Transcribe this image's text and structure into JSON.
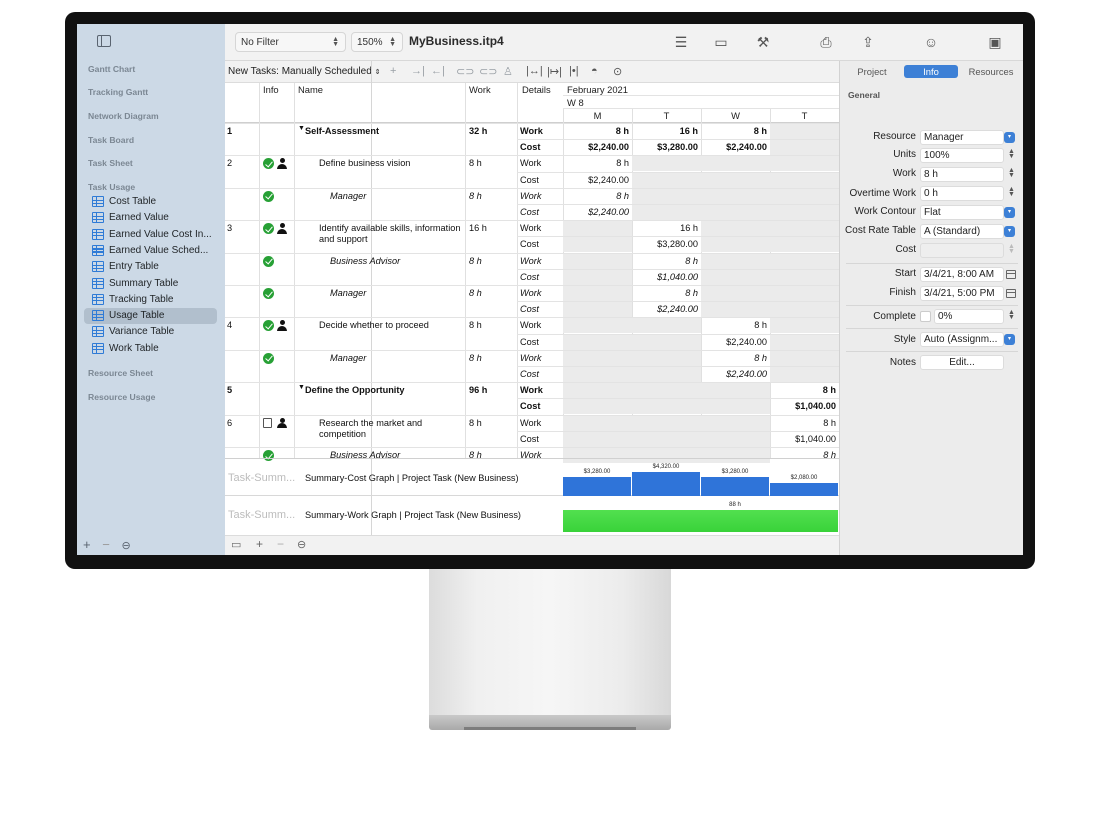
{
  "sidebar": {
    "sections": {
      "gantt": "Gantt Chart",
      "tracking": "Tracking Gantt",
      "network": "Network Diagram",
      "board": "Task Board",
      "sheet": "Task Sheet",
      "usage": "Task Usage",
      "res_sheet": "Resource Sheet",
      "res_usage": "Resource Usage"
    },
    "items": [
      {
        "label": "Cost Table"
      },
      {
        "label": "Earned Value"
      },
      {
        "label": "Earned Value Cost In..."
      },
      {
        "label": "Earned Value Sched..."
      },
      {
        "label": "Entry Table"
      },
      {
        "label": "Summary Table"
      },
      {
        "label": "Tracking Table"
      },
      {
        "label": "Usage Table"
      },
      {
        "label": "Variance Table"
      },
      {
        "label": "Work Table"
      }
    ],
    "selected": "Usage Table"
  },
  "toolbar": {
    "filter": "No Filter",
    "zoom": "150%",
    "title": "MyBusiness.itp4"
  },
  "bar2": {
    "new_tasks": "New Tasks: Manually Scheduled"
  },
  "table": {
    "headers": {
      "info": "Info",
      "name": "Name",
      "work": "Work",
      "details": "Details"
    },
    "timescale": {
      "month": "February 2021",
      "week": "W 8",
      "days": [
        "M",
        "T",
        "W",
        "T"
      ]
    },
    "rows": [
      {
        "id": "1",
        "name": "Self-Assessment",
        "work": "32 h",
        "type": "summary",
        "lines": [
          [
            "Work",
            "8 h",
            "16 h",
            "8 h",
            ""
          ],
          [
            "Cost",
            "$2,240.00",
            "$3,280.00",
            "$2,240.00",
            ""
          ]
        ]
      },
      {
        "id": "2",
        "name": "Define business vision",
        "work": "8 h",
        "type": "task",
        "lines": [
          [
            "Work",
            "8 h",
            "",
            "",
            ""
          ],
          [
            "Cost",
            "$2,240.00",
            "",
            "",
            ""
          ]
        ]
      },
      {
        "id": "",
        "name": "Manager",
        "work": "8 h",
        "type": "assign",
        "lines": [
          [
            "Work",
            "8 h",
            "",
            "",
            ""
          ],
          [
            "Cost",
            "$2,240.00",
            "",
            "",
            ""
          ]
        ]
      },
      {
        "id": "3",
        "name": "Identify available skills, information",
        "name2": "and support",
        "work": "16 h",
        "type": "task",
        "lines": [
          [
            "Work",
            "",
            "16 h",
            "",
            ""
          ],
          [
            "Cost",
            "",
            "$3,280.00",
            "",
            ""
          ]
        ]
      },
      {
        "id": "",
        "name": "Business Advisor",
        "work": "8 h",
        "type": "assign",
        "lines": [
          [
            "Work",
            "",
            "8 h",
            "",
            ""
          ],
          [
            "Cost",
            "",
            "$1,040.00",
            "",
            ""
          ]
        ]
      },
      {
        "id": "",
        "name": "Manager",
        "work": "8 h",
        "type": "assign",
        "lines": [
          [
            "Work",
            "",
            "8 h",
            "",
            ""
          ],
          [
            "Cost",
            "",
            "$2,240.00",
            "",
            ""
          ]
        ]
      },
      {
        "id": "4",
        "name": "Decide whether to proceed",
        "work": "8 h",
        "type": "task",
        "lines": [
          [
            "Work",
            "",
            "",
            "8 h",
            ""
          ],
          [
            "Cost",
            "",
            "",
            "$2,240.00",
            ""
          ]
        ]
      },
      {
        "id": "",
        "name": "Manager",
        "work": "8 h",
        "type": "assign",
        "lines": [
          [
            "Work",
            "",
            "",
            "8 h",
            ""
          ],
          [
            "Cost",
            "",
            "",
            "$2,240.00",
            ""
          ]
        ]
      },
      {
        "id": "5",
        "name": "Define the Opportunity",
        "work": "96 h",
        "type": "summary",
        "lines": [
          [
            "Work",
            "",
            "",
            "",
            "8 h"
          ],
          [
            "Cost",
            "",
            "",
            "",
            "$1,040.00"
          ]
        ]
      },
      {
        "id": "6",
        "name": "Research the market and",
        "name2": "competition",
        "work": "8 h",
        "type": "task6",
        "lines": [
          [
            "Work",
            "",
            "",
            "",
            "8 h"
          ],
          [
            "Cost",
            "",
            "",
            "",
            "$1,040.00"
          ]
        ]
      },
      {
        "id": "",
        "name": "Business Advisor",
        "work": "8 h",
        "type": "assign",
        "lines": [
          [
            "Work",
            "",
            "",
            "",
            "8 h"
          ]
        ]
      }
    ]
  },
  "graphs": {
    "cost": {
      "ghost": "Task-Summ...",
      "label": "Summary-Cost Graph | Project Task (New Business)",
      "values": [
        3280,
        4320,
        3280,
        2080
      ],
      "labels": [
        "$3,280.00",
        "$4,320.00",
        "$3,280.00",
        "$2,080.00"
      ],
      "color": "#2f74d9"
    },
    "work": {
      "ghost": "Task-Summ...",
      "label": "Summary-Work Graph | Project Task (New Business)",
      "value_label": "88 h",
      "color": "#39d23a"
    }
  },
  "inspector": {
    "tabs": [
      "Project",
      "Info",
      "Resources"
    ],
    "active_tab": "Info",
    "section": "General",
    "fields": {
      "resource": {
        "label": "Resource",
        "value": "Manager"
      },
      "units": {
        "label": "Units",
        "value": "100%"
      },
      "work": {
        "label": "Work",
        "value": "8 h"
      },
      "overtime": {
        "label": "Overtime Work",
        "value": "0 h"
      },
      "contour": {
        "label": "Work Contour",
        "value": "Flat"
      },
      "rate_table": {
        "label": "Cost Rate Table",
        "value": "A (Standard)"
      },
      "cost": {
        "label": "Cost",
        "value": ""
      },
      "start": {
        "label": "Start",
        "value": "3/4/21, 8:00 AM"
      },
      "finish": {
        "label": "Finish",
        "value": "3/4/21, 5:00 PM"
      },
      "complete": {
        "label": "Complete",
        "value": "0%"
      },
      "style": {
        "label": "Style",
        "value": "Auto (Assignm..."
      },
      "notes": {
        "label": "Notes",
        "value": "Edit..."
      }
    }
  }
}
